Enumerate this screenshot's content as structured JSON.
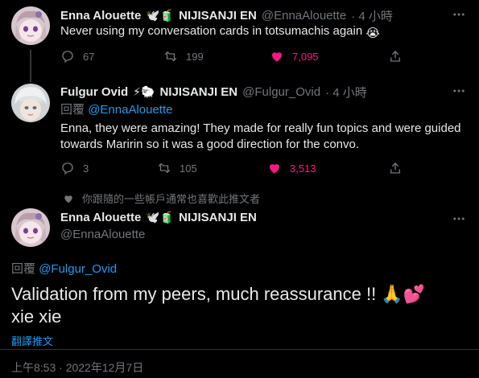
{
  "tweet1": {
    "display_name": "Enna Alouette",
    "name_emoji": "🕊️🧃",
    "org": "NIJISANJI EN",
    "handle": "@EnnaAlouette",
    "time": "· 4 小時",
    "text": "Never using my conversation cards in totsumachis again",
    "text_emoji": "😭",
    "replies": "67",
    "retweets": "199",
    "likes": "7,095"
  },
  "tweet2": {
    "display_name": "Fulgur Ovid",
    "name_emoji": "⚡🐑",
    "org": "NIJISANJI EN",
    "handle": "@Fulgur_Ovid",
    "time": "· 4 小時",
    "reply_prefix": "回覆",
    "reply_to": "@EnnaAlouette",
    "text_line1": "Enna, they were amazing! They made for really fun topics and were guided",
    "text_line2": "towards Maririn so it was a good direction for the convo.",
    "replies": "3",
    "retweets": "105",
    "likes": "3,513"
  },
  "social_context": {
    "text": "你跟隨的一些帳戶通常也喜歡此推文者"
  },
  "main_tweet": {
    "display_name": "Enna Alouette",
    "name_emoji": "🕊️🧃",
    "org": "NIJISANJI EN",
    "handle": "@EnnaAlouette",
    "reply_prefix": "回覆",
    "reply_to": "@Fulgur_Ovid",
    "text_line1": "Validation from my peers, much reassurance !!",
    "text_emoji": "🙏💕",
    "text_line2": "xie xie",
    "translate": "翻譯推文",
    "timestamp": "上午8:53 · 2022年12月7日"
  },
  "colors": {
    "background": "#000000",
    "text": "#e7e9ea",
    "muted": "#71767b",
    "link": "#1d9bf0",
    "like": "#f91880",
    "divider": "#2f3336"
  },
  "icons": [
    "more-icon",
    "reply-icon",
    "retweet-icon",
    "like-icon",
    "share-icon",
    "info-icon"
  ]
}
